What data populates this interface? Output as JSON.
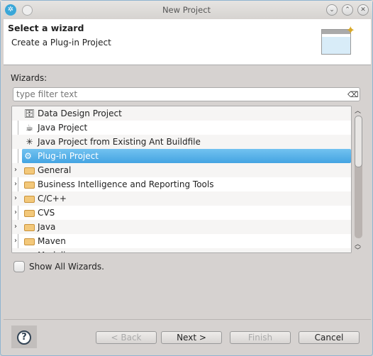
{
  "window": {
    "title": "New Project"
  },
  "header": {
    "title": "Select a wizard",
    "subtitle": "Create a Plug-in Project"
  },
  "wizards_label": "Wizards:",
  "filter": {
    "placeholder": "type filter text",
    "value": ""
  },
  "tree": [
    {
      "label": "Data Design Project",
      "icon": "data-design-icon",
      "expandable": false
    },
    {
      "label": "Java Project",
      "icon": "java-project-icon",
      "expandable": false
    },
    {
      "label": "Java Project from Existing Ant Buildfile",
      "icon": "ant-icon",
      "expandable": false
    },
    {
      "label": "Plug-in Project",
      "icon": "plugin-project-icon",
      "expandable": false,
      "selected": true
    },
    {
      "label": "General",
      "icon": "folder-icon",
      "expandable": true
    },
    {
      "label": "Business Intelligence and Reporting Tools",
      "icon": "folder-icon",
      "expandable": true
    },
    {
      "label": "C/C++",
      "icon": "folder-icon",
      "expandable": true
    },
    {
      "label": "CVS",
      "icon": "folder-icon",
      "expandable": true
    },
    {
      "label": "Java",
      "icon": "folder-icon",
      "expandable": true
    },
    {
      "label": "Maven",
      "icon": "folder-icon",
      "expandable": true
    },
    {
      "label": "Modeling",
      "icon": "folder-icon",
      "expandable": true
    }
  ],
  "show_all": {
    "label": "Show All Wizards.",
    "checked": false
  },
  "buttons": {
    "back": "< Back",
    "next": "Next >",
    "finish": "Finish",
    "cancel": "Cancel"
  },
  "colors": {
    "selection": "#4aa8e4"
  }
}
